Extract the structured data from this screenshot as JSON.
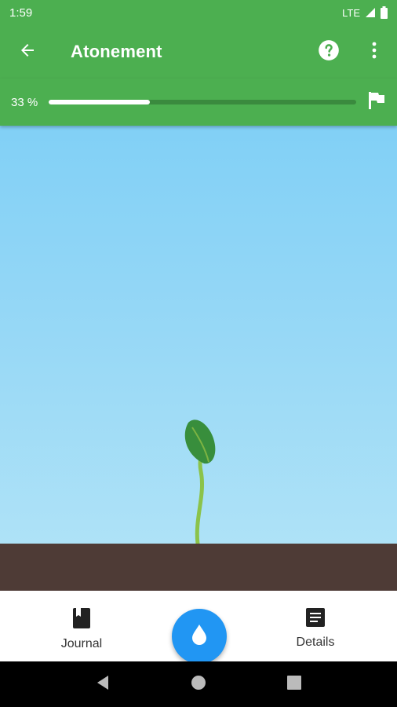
{
  "status_bar": {
    "time": "1:59",
    "network": "LTE"
  },
  "app_bar": {
    "title": "Atonement",
    "icons": [
      "back-arrow-icon",
      "help-icon",
      "more-vert-icon"
    ]
  },
  "progress": {
    "label": "33 %",
    "value": 0.33,
    "end_icon": "flag-icon"
  },
  "bottom_nav": {
    "journal_label": "Journal",
    "details_label": "Details",
    "fab_icon": "water-drop-icon"
  },
  "colors": {
    "primary": "#4CAF50",
    "fab": "#2196F3",
    "sky_top": "#81D0F6",
    "sky_bottom": "#AEE2F7",
    "soil": "#4E3B36",
    "leaf": "#388E3C",
    "stem": "#8BC34A"
  }
}
